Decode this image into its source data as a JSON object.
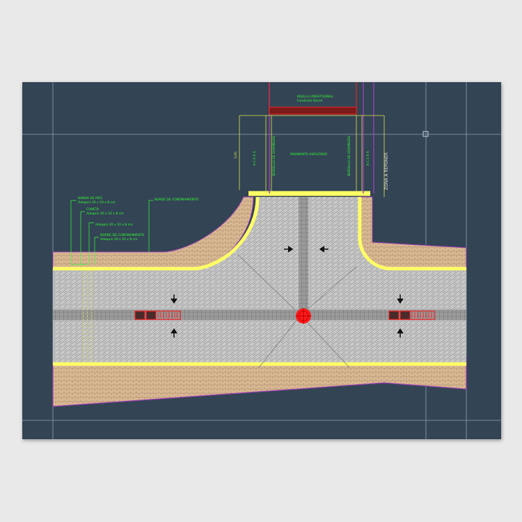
{
  "colors": {
    "background": "#334454",
    "paper": "#e9e9e9",
    "road_paving": "#c9c9c9",
    "sidewalk": "#d9b894",
    "curb": "#ffff66",
    "annotation": "#33ff33",
    "dimension": "#e6e64d",
    "property_line": "#9b3fb3",
    "hydrant": "#ff1a1a",
    "grid": "#8fa0b0"
  },
  "labels": {
    "rejilla": [
      "REJILLA LONGITUDINAL",
      "Fundición Dúctil"
    ],
    "pavimento": "PAVIMENTO ASFALTADO",
    "bordillo_left": "BORDILLO DE HORMIGÓN",
    "bordillo_right": "BORDILLO DE HORMIGÓN",
    "acera_left": "A C E R A",
    "acera_right": "A C E R A",
    "zona": "ZONA A REPONER",
    "dim": "3,00",
    "bordo_conf": "BORDE DE CONFINAMIENTO",
    "ann1": [
      "BANDA DE PIES",
      "Adoquín 20 x 10 x 8 cm"
    ],
    "ann2": [
      "CUNETA",
      "Adoquín 20 x 10 x 8 cm"
    ],
    "ann3": [
      "Adoquín 20 x 10 x 8 cm"
    ],
    "ann4": [
      "BORDE DE CONFINAMIENTO",
      "Adoquín 20 x 10 x 8 cm"
    ]
  }
}
